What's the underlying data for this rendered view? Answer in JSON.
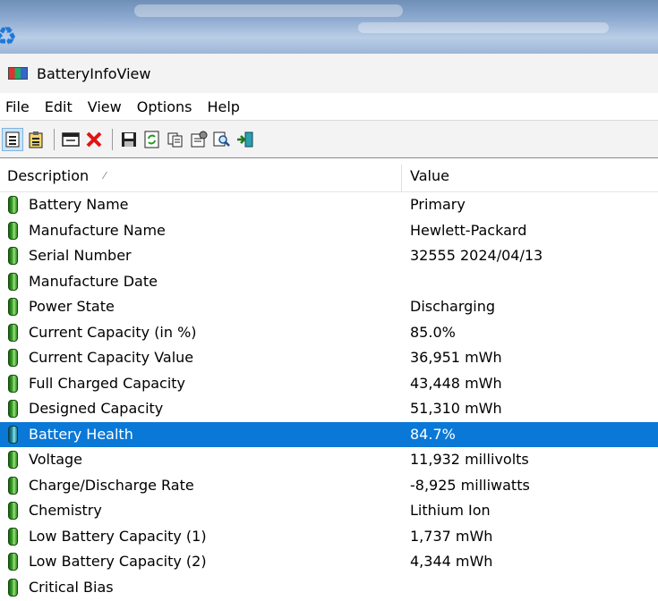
{
  "window": {
    "title": "BatteryInfoView"
  },
  "menu": [
    "File",
    "Edit",
    "View",
    "Options",
    "Help"
  ],
  "table": {
    "columns": {
      "description": "Description",
      "value": "Value"
    },
    "rows": [
      {
        "description": "Battery Name",
        "value": "Primary"
      },
      {
        "description": "Manufacture Name",
        "value": "Hewlett-Packard"
      },
      {
        "description": "Serial Number",
        "value": "32555 2024/04/13"
      },
      {
        "description": "Manufacture Date",
        "value": ""
      },
      {
        "description": "Power State",
        "value": "Discharging"
      },
      {
        "description": "Current Capacity (in %)",
        "value": "85.0%"
      },
      {
        "description": "Current Capacity Value",
        "value": "36,951 mWh"
      },
      {
        "description": "Full Charged Capacity",
        "value": "43,448 mWh"
      },
      {
        "description": "Designed Capacity",
        "value": "51,310 mWh"
      },
      {
        "description": "Battery Health",
        "value": "84.7%"
      },
      {
        "description": "Voltage",
        "value": "11,932 millivolts"
      },
      {
        "description": "Charge/Discharge Rate",
        "value": "-8,925 milliwatts"
      },
      {
        "description": "Chemistry",
        "value": "Lithium Ion"
      },
      {
        "description": "Low Battery Capacity (1)",
        "value": "1,737 mWh"
      },
      {
        "description": "Low Battery Capacity (2)",
        "value": "4,344 mWh"
      },
      {
        "description": "Critical Bias",
        "value": ""
      }
    ]
  },
  "colors": {
    "selection": "#0a78d7",
    "battery_green": "#3fae2d"
  }
}
